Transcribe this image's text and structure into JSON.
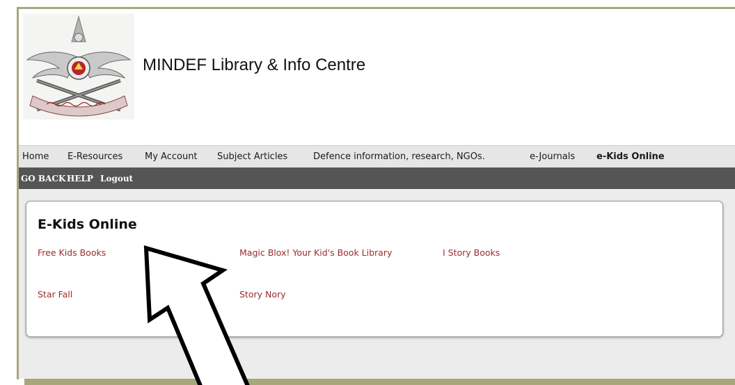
{
  "header": {
    "site_title": "MINDEF Library & Info Centre",
    "logo_icon": "mindef-emblem-logo"
  },
  "nav": {
    "items": [
      {
        "label": "Home"
      },
      {
        "label": "E-Resources"
      },
      {
        "label": "My Account"
      },
      {
        "label": "Subject Articles"
      },
      {
        "label": "Defence information, research, NGOs."
      },
      {
        "label": "e-Journals"
      },
      {
        "label": "e-Kids Online",
        "active": true
      }
    ]
  },
  "subnav": {
    "items": [
      {
        "label": "GO BACK"
      },
      {
        "label": "HELP"
      },
      {
        "label": "Logout"
      }
    ]
  },
  "panel": {
    "title": "E-Kids Online",
    "links": [
      {
        "label": "Free Kids Books"
      },
      {
        "label": "Magic Blox! Your Kid's Book Library"
      },
      {
        "label": "I Story Books"
      },
      {
        "label": "Star Fall"
      },
      {
        "label": "Story Nory"
      }
    ]
  },
  "colors": {
    "frame": "#a8a67a",
    "subnav_bg": "#555555",
    "link": "#9b2a2a",
    "content_bg": "#ececec"
  }
}
